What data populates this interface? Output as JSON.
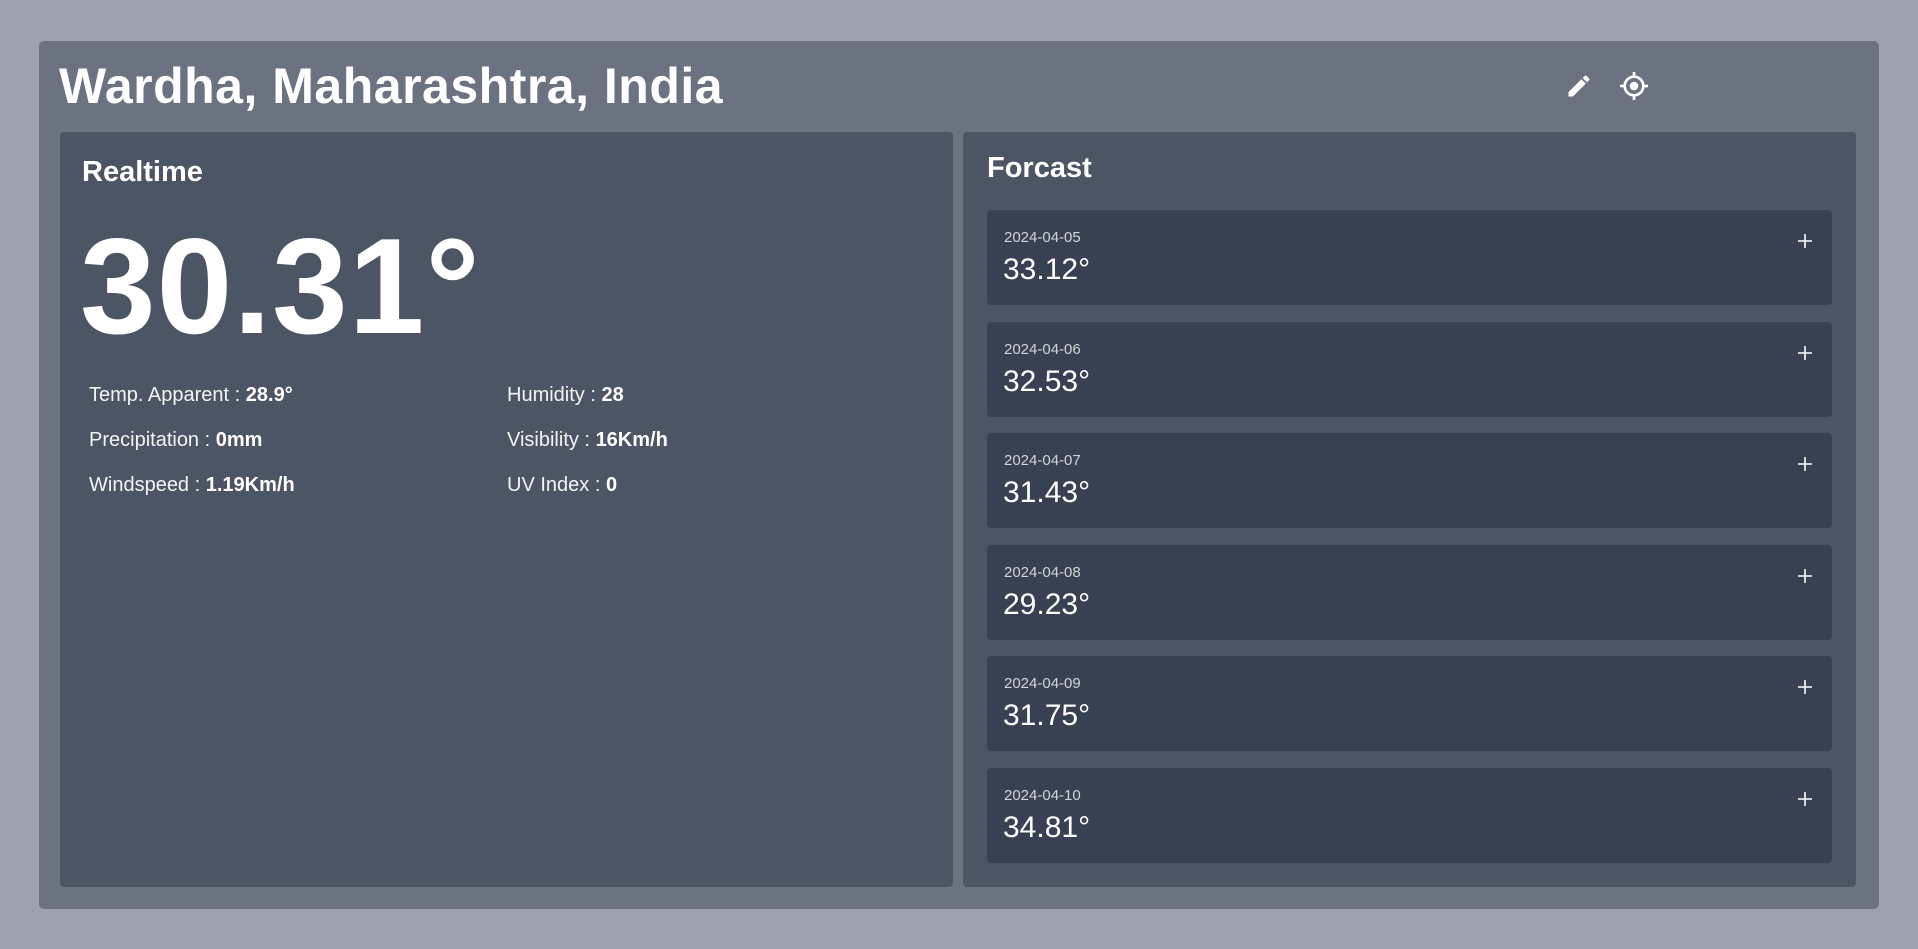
{
  "header": {
    "location": "Wardha, Maharashtra, India",
    "edit_icon": "pencil-icon",
    "locate_icon": "crosshair-icon"
  },
  "realtime": {
    "title": "Realtime",
    "temperature": "30.31°",
    "stats": [
      {
        "label": "Temp. Apparent :",
        "value": "28.9°"
      },
      {
        "label": "Humidity :",
        "value": "28"
      },
      {
        "label": "Precipitation :",
        "value": "0mm"
      },
      {
        "label": "Visibility :",
        "value": "16Km/h"
      },
      {
        "label": "Windspeed :",
        "value": "1.19Km/h"
      },
      {
        "label": "UV Index :",
        "value": "0"
      }
    ]
  },
  "forecast": {
    "title": "Forcast",
    "expand_icon": "plus-icon",
    "days": [
      {
        "date": "2024-04-05",
        "temp": "33.12°"
      },
      {
        "date": "2024-04-06",
        "temp": "32.53°"
      },
      {
        "date": "2024-04-07",
        "temp": "31.43°"
      },
      {
        "date": "2024-04-08",
        "temp": "29.23°"
      },
      {
        "date": "2024-04-09",
        "temp": "31.75°"
      },
      {
        "date": "2024-04-10",
        "temp": "34.81°"
      }
    ]
  },
  "colors": {
    "page_bg": "#9ca3af",
    "app_bg": "#6b7280",
    "panel_bg": "#4b5563",
    "card_bg": "#374151",
    "text": "#ffffff"
  }
}
